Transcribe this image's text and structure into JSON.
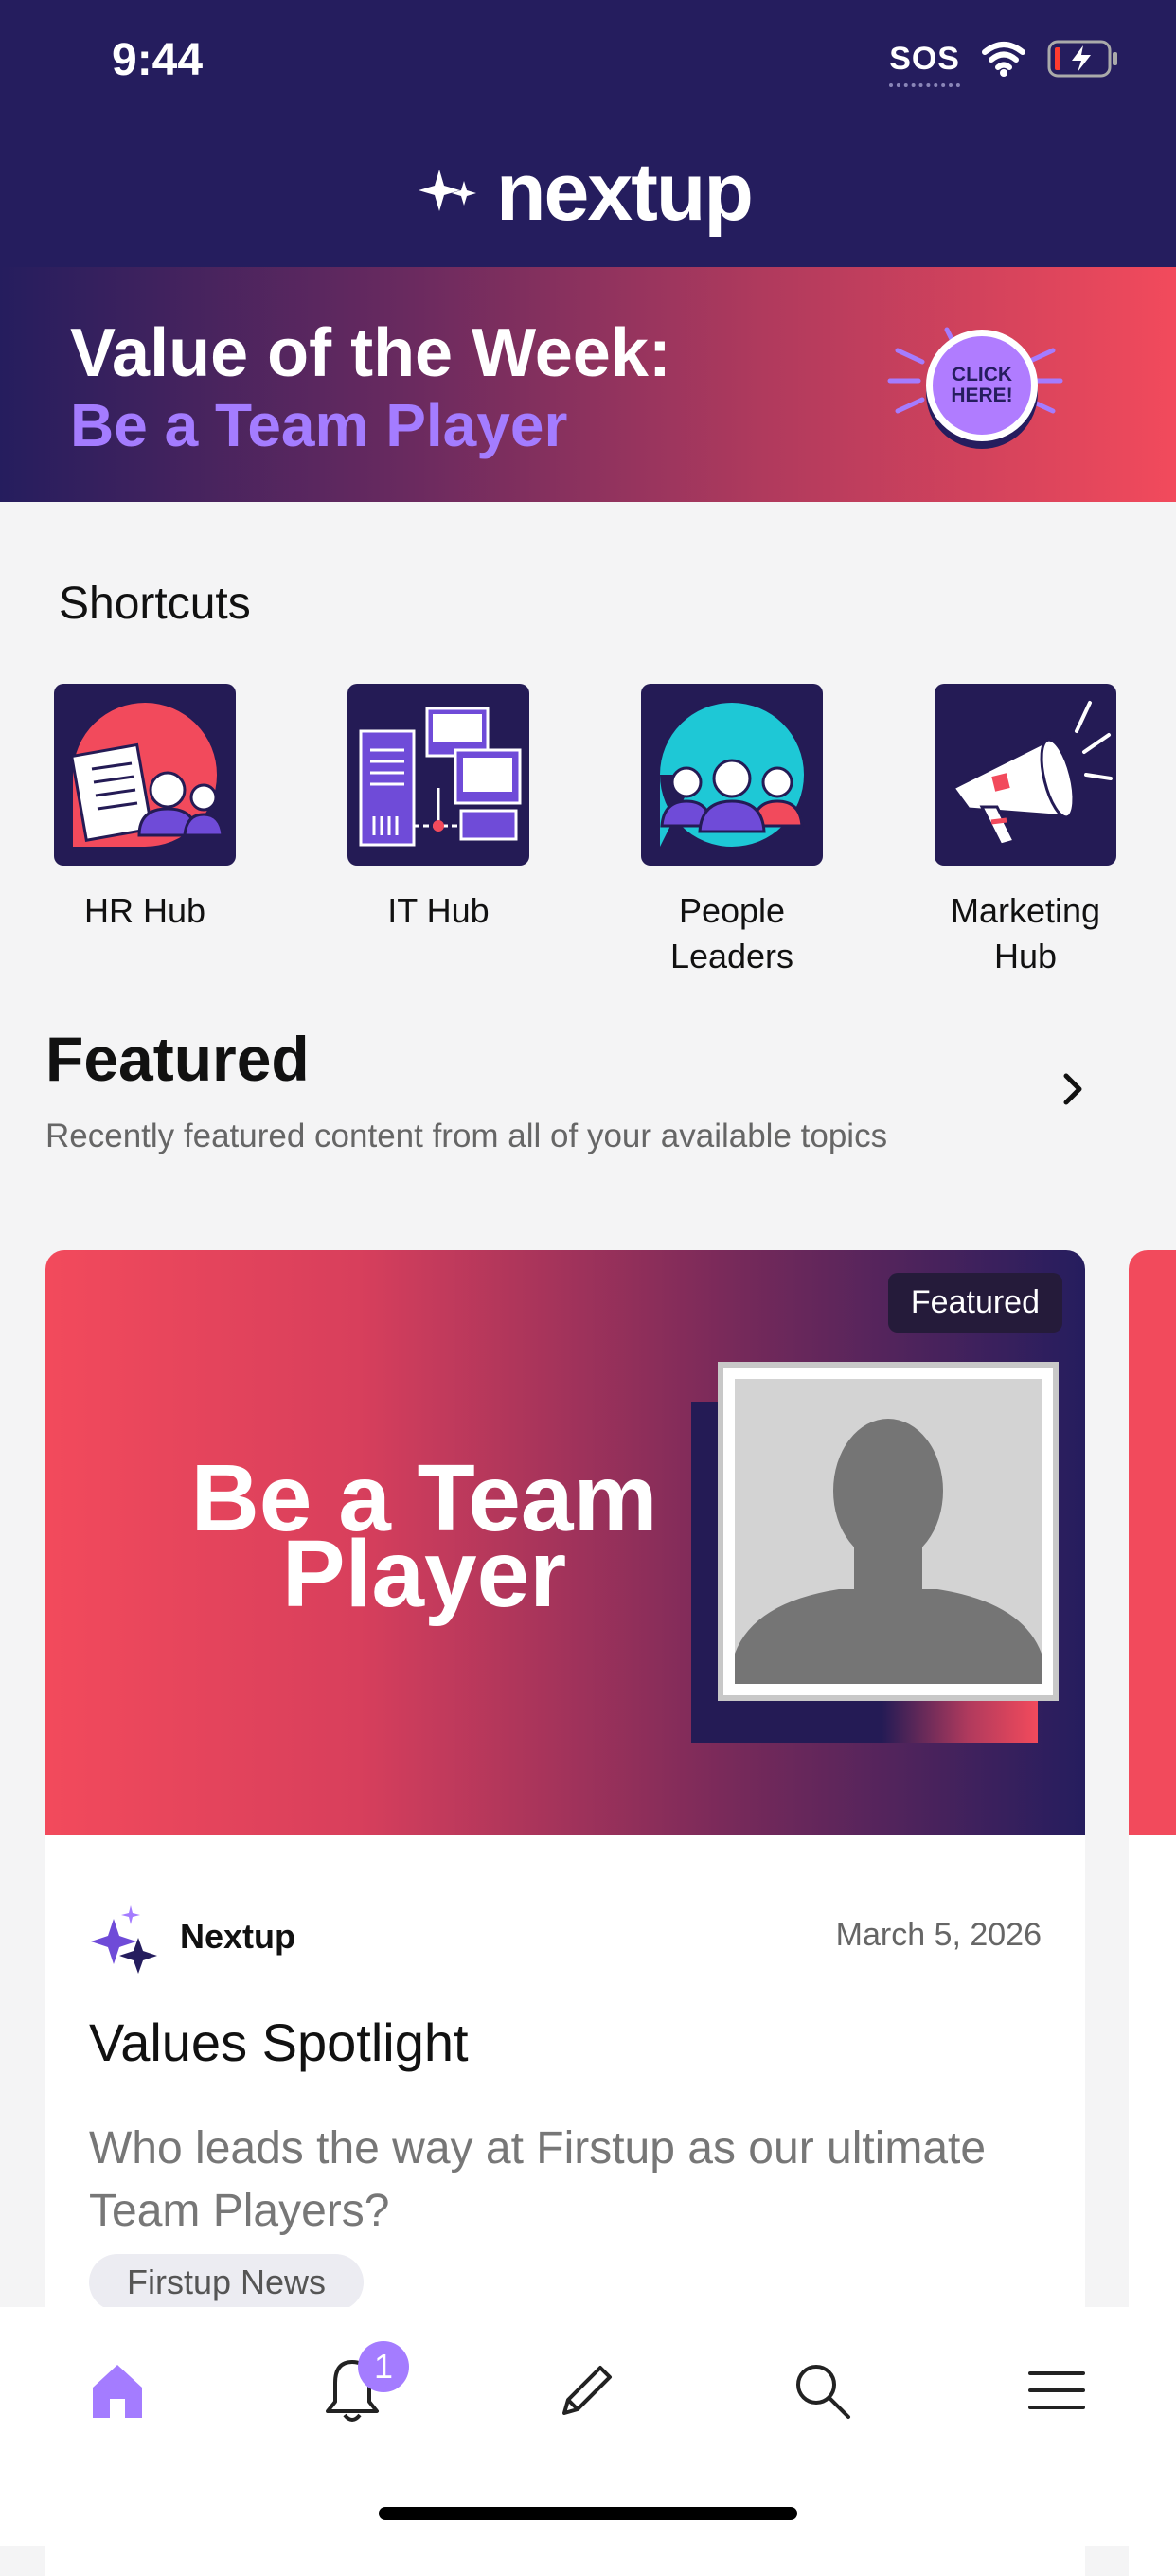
{
  "status_bar": {
    "time": "9:44",
    "sos": "SOS"
  },
  "header": {
    "logo_text": "nextup"
  },
  "banner": {
    "title": "Value of the Week:",
    "subtitle": "Be a Team Player",
    "cta": "CLICK HERE!"
  },
  "shortcuts": {
    "title": "Shortcuts",
    "items": [
      {
        "label": "HR Hub",
        "icon": "hr-hub-icon"
      },
      {
        "label": "IT Hub",
        "icon": "it-hub-icon"
      },
      {
        "label": "People\nLeaders",
        "icon": "people-leaders-icon"
      },
      {
        "label": "Marketing\nHub",
        "icon": "marketing-hub-icon"
      }
    ]
  },
  "featured": {
    "title": "Featured",
    "subtitle": "Recently featured content from all of your available topics",
    "card": {
      "badge": "Featured",
      "hero_text": "Be a Team Player",
      "author": "Nextup",
      "date": "March 5, 2026",
      "title": "Values Spotlight",
      "description": "Who leads the way at Firstup as our ultimate Team Players?",
      "tag": "Firstup News"
    }
  },
  "tab_bar": {
    "items": [
      "home-icon",
      "bell-icon",
      "pencil-icon",
      "search-icon",
      "menu-icon"
    ],
    "notification_count": "1"
  },
  "colors": {
    "brand": "#251d5e",
    "accent": "#a47cff",
    "coral": "#f24a5c"
  }
}
